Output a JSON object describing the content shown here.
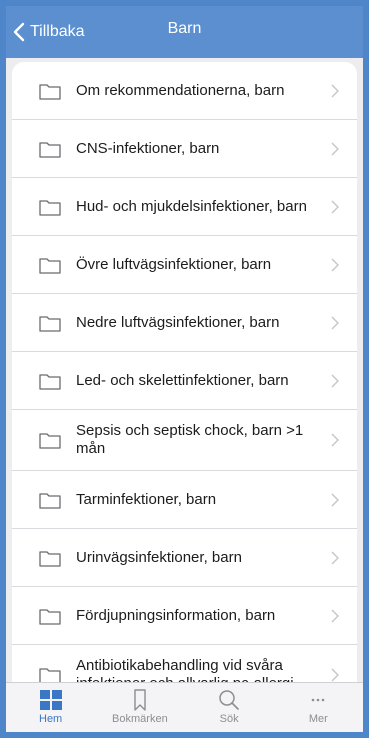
{
  "navbar": {
    "back_label": "Tillbaka",
    "title": "Barn"
  },
  "list": {
    "items": [
      {
        "label": "Om rekommendationerna, barn"
      },
      {
        "label": "CNS-infektioner, barn"
      },
      {
        "label": "Hud- och mjukdelsinfektioner, barn"
      },
      {
        "label": "Övre luftvägsinfektioner, barn"
      },
      {
        "label": "Nedre luftvägsinfektioner, barn"
      },
      {
        "label": "Led- och skelettinfektioner, barn"
      },
      {
        "label": "Sepsis och septisk chock, barn >1 mån"
      },
      {
        "label": "Tarminfektioner, barn"
      },
      {
        "label": "Urinvägsinfektioner, barn"
      },
      {
        "label": "Fördjupningsinformation, barn"
      },
      {
        "label": "Antibiotikabehandling vid svåra infektioner och allvarlig pc-allergi"
      }
    ]
  },
  "tabbar": {
    "tabs": [
      {
        "label": "Hem",
        "icon": "grid-icon",
        "active": true
      },
      {
        "label": "Bokmärken",
        "icon": "bookmark-icon",
        "active": false
      },
      {
        "label": "Sök",
        "icon": "search-icon",
        "active": false
      },
      {
        "label": "Mer",
        "icon": "more-icon",
        "active": false
      }
    ]
  },
  "colors": {
    "accent": "#3a77c4",
    "navbar": "#5b8fd0",
    "frame": "#4f86c9"
  }
}
